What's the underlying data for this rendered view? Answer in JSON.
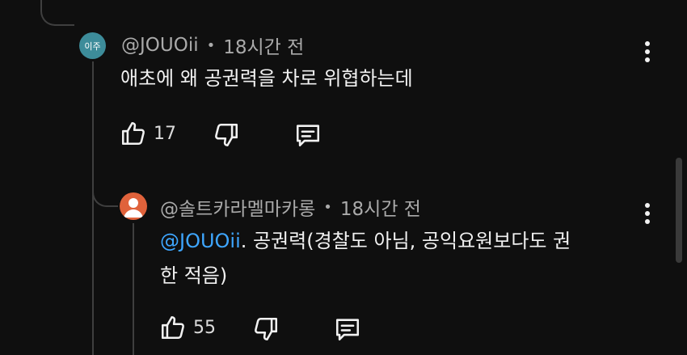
{
  "comments": [
    {
      "avatar_text": "이주",
      "avatar_color": "#3d8c9a",
      "username": "@JOUOii",
      "separator": "•",
      "timestamp": "18시간 전",
      "text_lines": [
        "애초에 왜 공권력을 차로 위협하는데"
      ],
      "likes": "17",
      "menu_icon": "more-vert-icon"
    },
    {
      "avatar_color": "#e0623b",
      "username": "@솔트카라멜마카롱",
      "separator": "•",
      "timestamp": "18시간 전",
      "mention": "@JOUOii",
      "text_line1_rest": ". 공권력(경찰도 아님, 공익요원보다도 권",
      "text_line2": "한 적음)",
      "likes": "55",
      "menu_icon": "more-vert-icon"
    }
  ],
  "colors": {
    "background": "#0f0f0f",
    "text": "#f1f1f1",
    "meta": "#aaaaaa",
    "mention": "#3ea6ff",
    "thread_line": "#3f3f3f"
  }
}
